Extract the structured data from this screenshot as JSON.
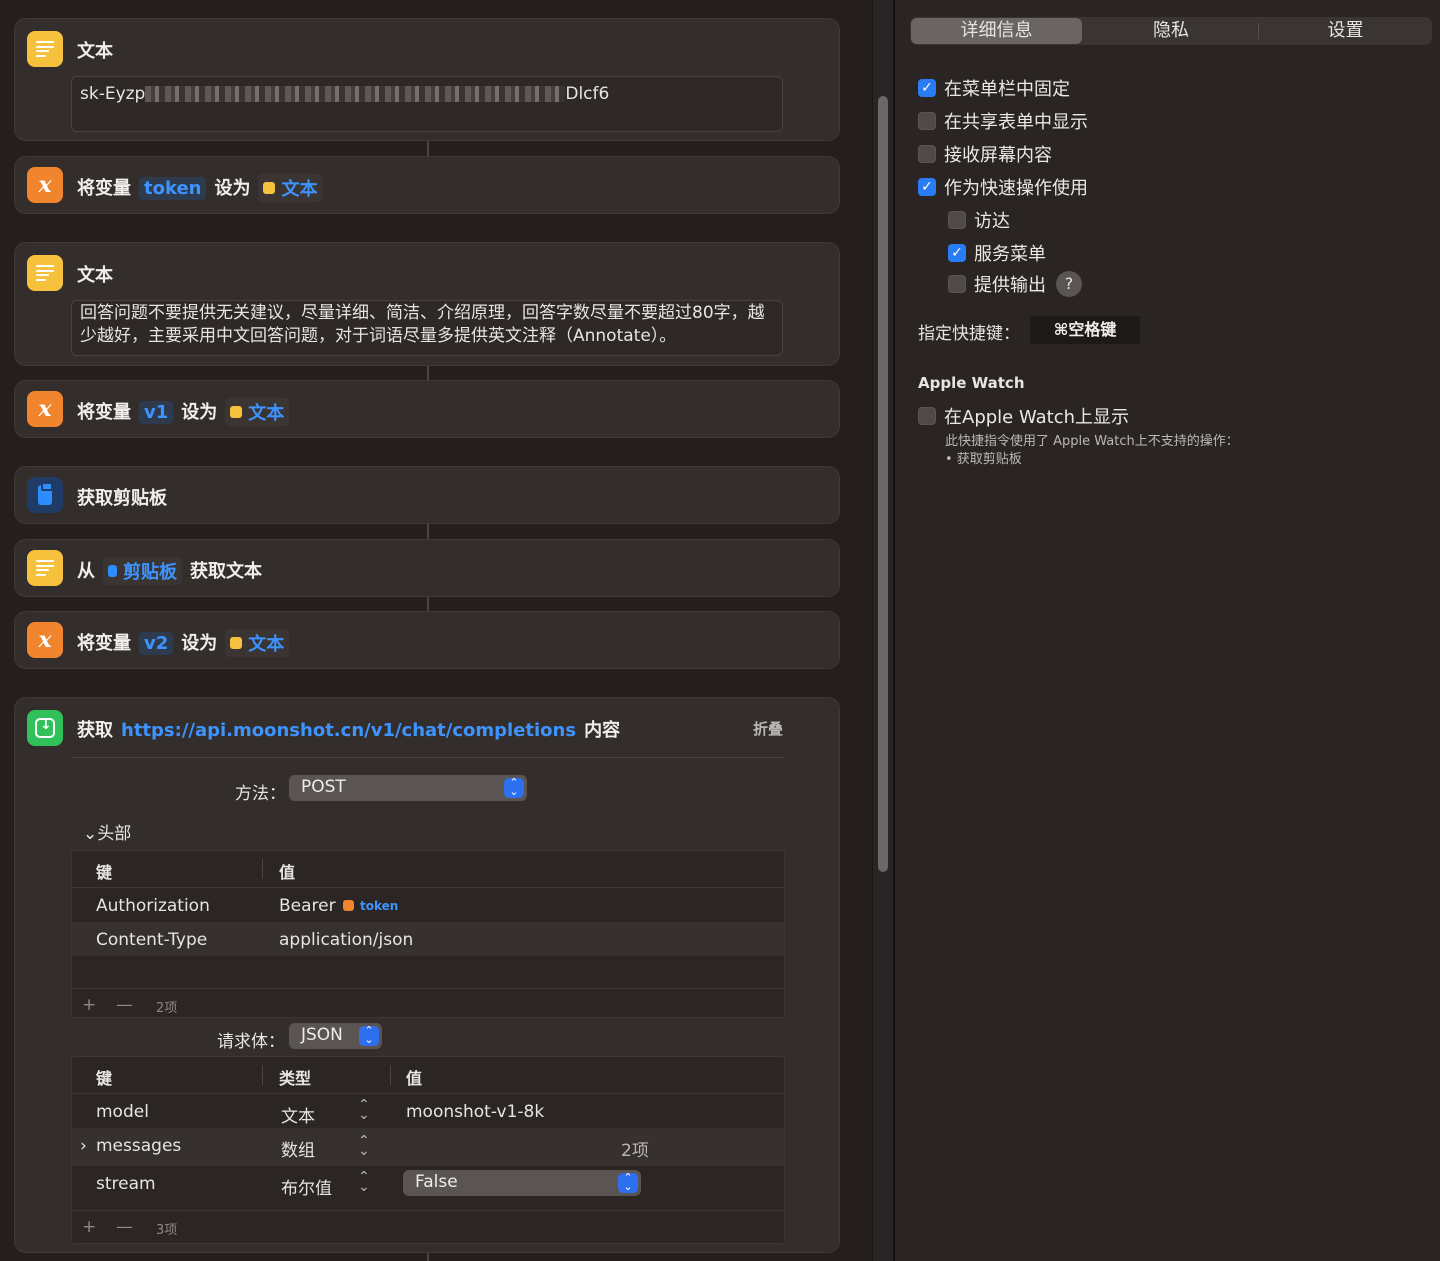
{
  "actions": {
    "text1": {
      "title": "文本",
      "value_start": "sk-Eyzp",
      "value_end": "Dlcf6"
    },
    "setvar1": {
      "prefix": "将变量",
      "var": "token",
      "mid": "设为",
      "chip": "文本"
    },
    "text2": {
      "title": "文本",
      "value": "回答问题不要提供无关建议，尽量详细、简洁、介绍原理，回答字数尽量不要超过80字，越少越好，主要采用中文回答问题，对于词语尽量多提供英文注释（Annotate）。"
    },
    "setvar2": {
      "prefix": "将变量",
      "var": "v1",
      "mid": "设为",
      "chip": "文本"
    },
    "clipboard": {
      "title": "获取剪贴板"
    },
    "gettext": {
      "prefix": "从",
      "chip": "剪贴板",
      "suffix": "获取文本"
    },
    "setvar3": {
      "prefix": "将变量",
      "var": "v2",
      "mid": "设为",
      "chip": "文本"
    },
    "fetch": {
      "prefix": "获取",
      "url": "https://api.moonshot.cn/v1/chat/completions",
      "suffix": "内容",
      "fold": "折叠",
      "method_label": "方法：",
      "method": "POST",
      "headers_label": "头部",
      "headers_cols": [
        "键",
        "值"
      ],
      "headers": [
        {
          "key": "Authorization",
          "value": "Bearer",
          "token": "token"
        },
        {
          "key": "Content-Type",
          "value": "application/json"
        }
      ],
      "headers_count": "2项",
      "body_label": "请求体：",
      "body_type": "JSON",
      "body_cols": [
        "键",
        "类型",
        "值"
      ],
      "body": [
        {
          "key": "model",
          "type": "文本",
          "value": "moonshot-v1-8k"
        },
        {
          "key": "messages",
          "type": "数组",
          "value": "2项"
        },
        {
          "key": "stream",
          "type": "布尔值",
          "value": "False"
        }
      ],
      "body_count": "3项",
      "plus": "+",
      "minus": "—"
    }
  },
  "panel": {
    "tabs": [
      "详细信息",
      "隐私",
      "设置"
    ],
    "selected_tab": "详细信息",
    "options": [
      {
        "label": "在菜单栏中固定",
        "checked": true
      },
      {
        "label": "在共享表单中显示",
        "checked": false
      },
      {
        "label": "接收屏幕内容",
        "checked": false
      },
      {
        "label": "作为快速操作使用",
        "checked": true
      },
      {
        "label": "访达",
        "checked": false
      },
      {
        "label": "服务菜单",
        "checked": true
      },
      {
        "label": "提供输出",
        "checked": false
      }
    ],
    "help": "?",
    "hotkey_label": "指定快捷键：",
    "hotkey": "⌘空格键",
    "watch_heading": "Apple Watch",
    "watch_option": {
      "label": "在Apple Watch上显示",
      "checked": false
    },
    "watch_note": "此快捷指令使用了 Apple Watch上不支持的操作：",
    "watch_note_item": "• 获取剪贴板"
  }
}
